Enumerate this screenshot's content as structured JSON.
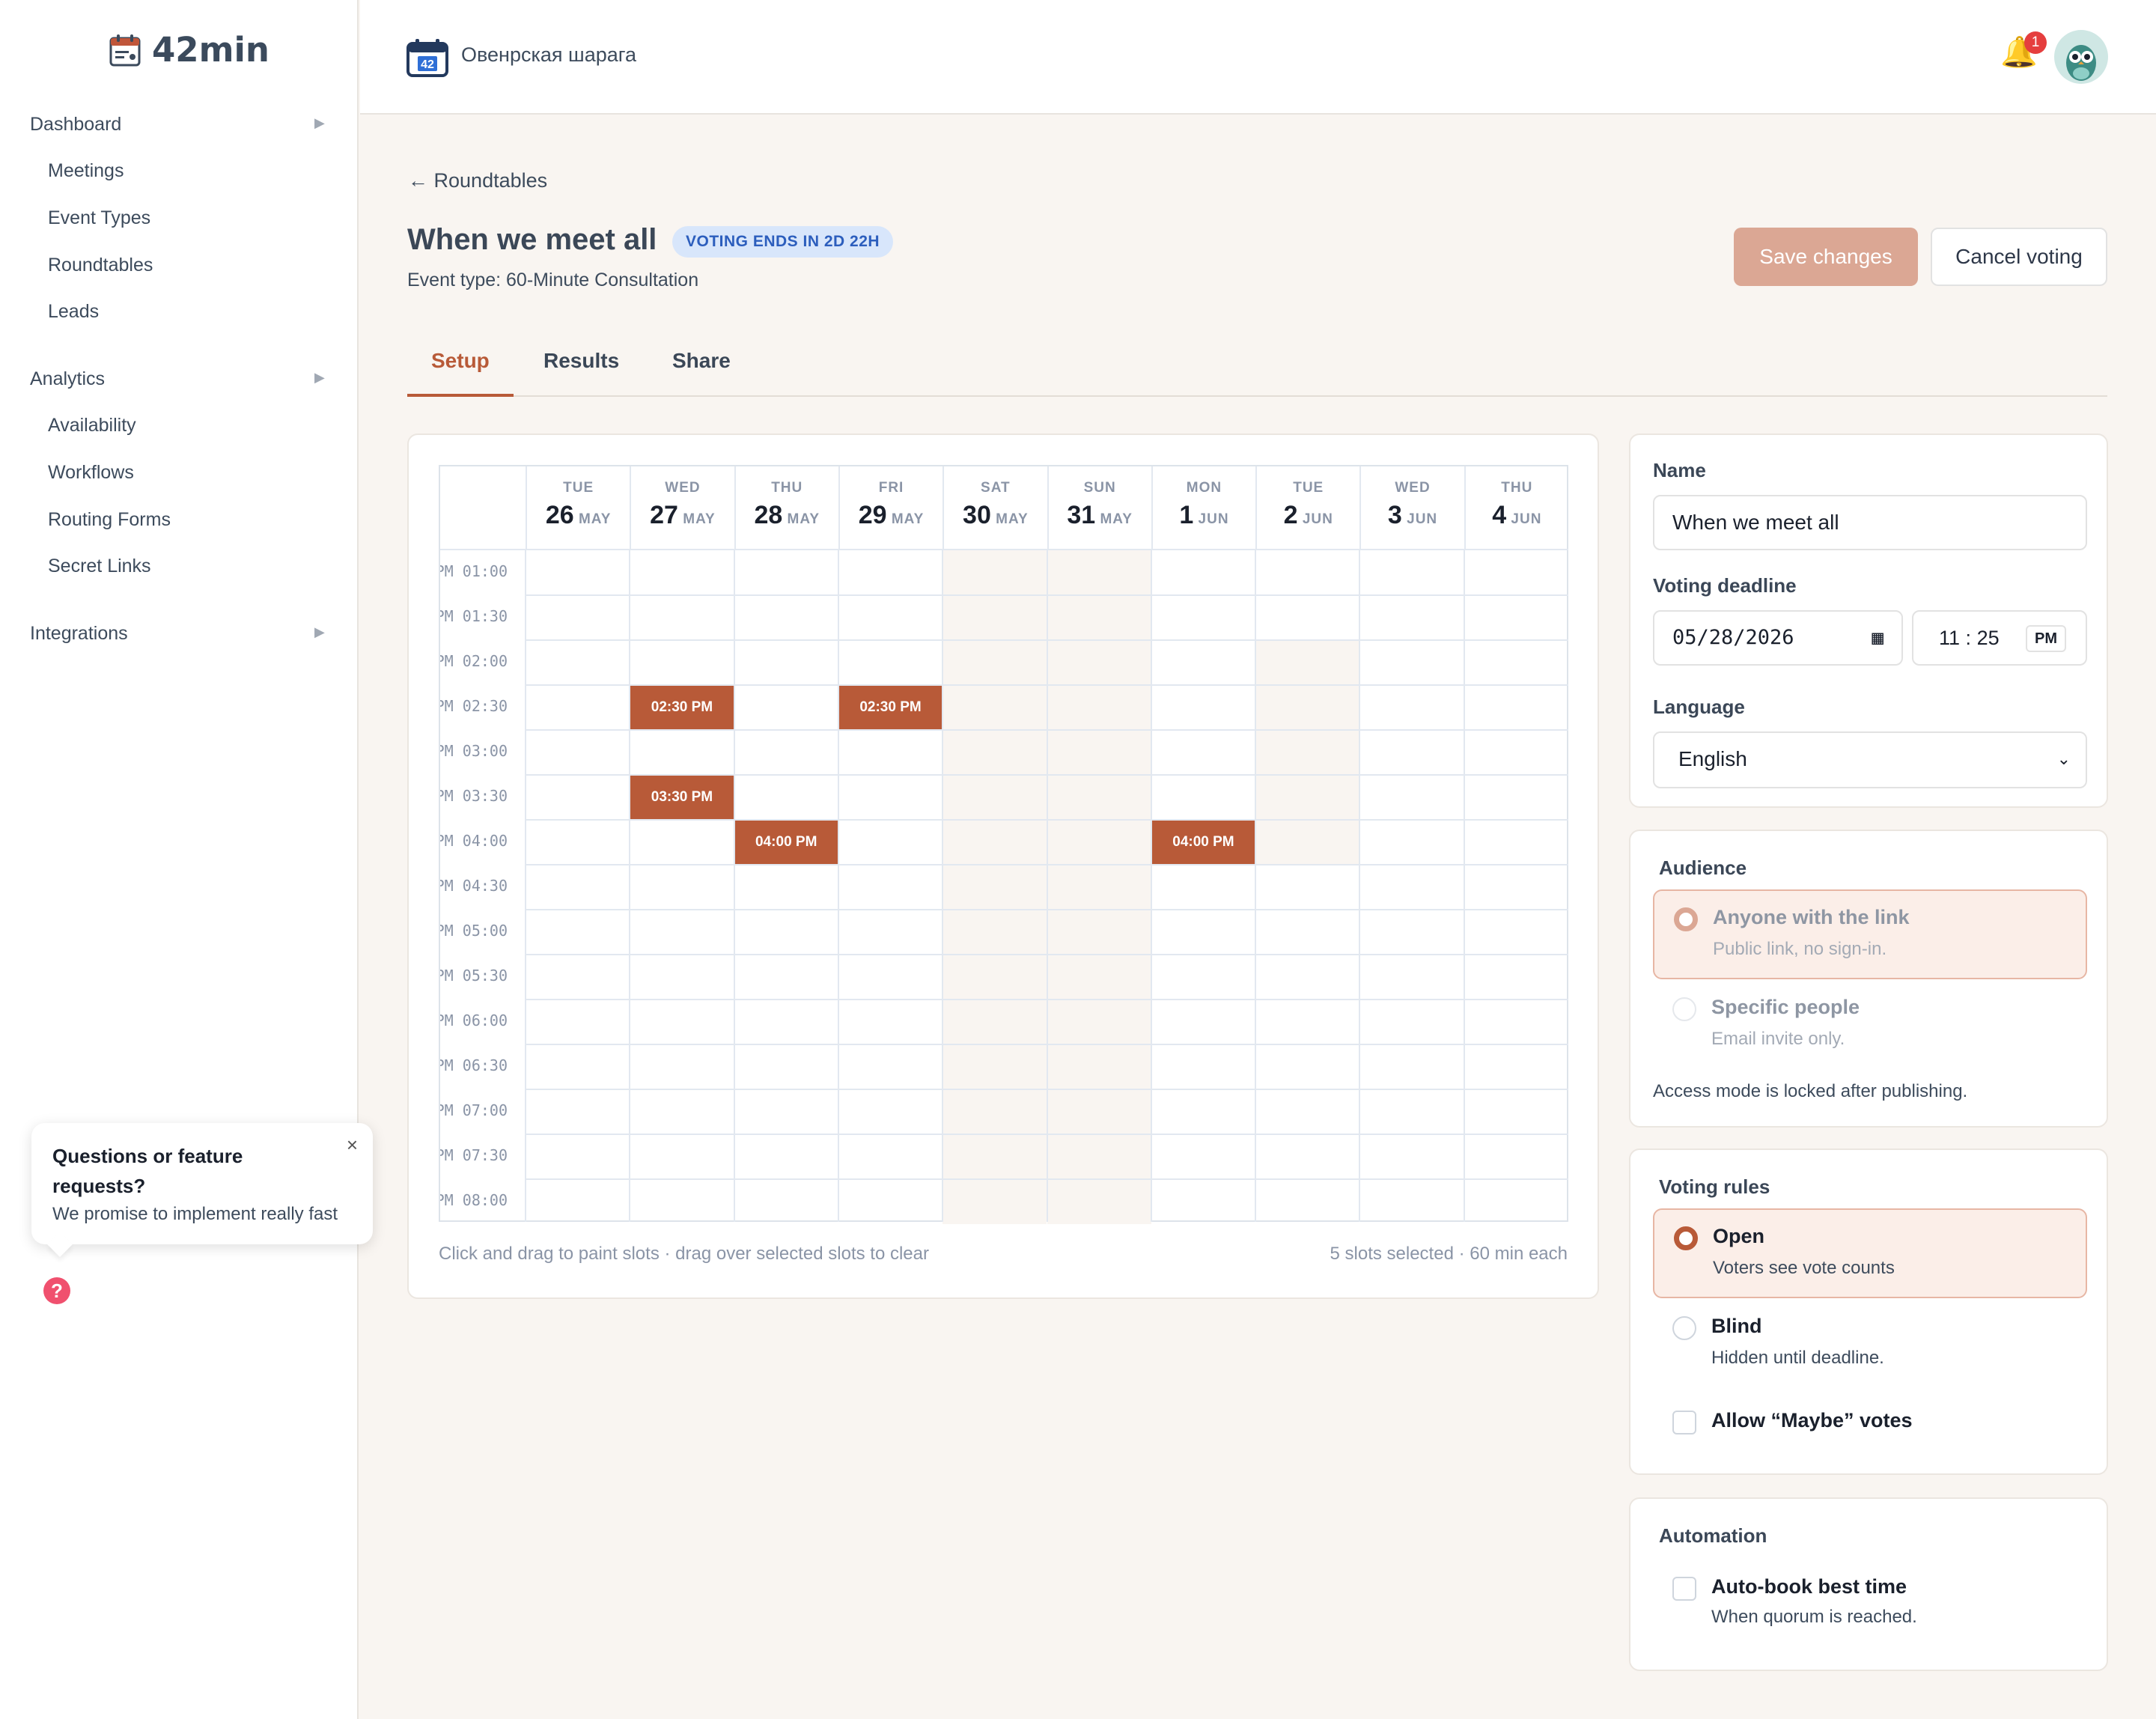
{
  "app": {
    "name": "42min"
  },
  "sidebar": {
    "groups": [
      {
        "label": "Dashboard",
        "items": [
          "Meetings",
          "Event Types",
          "Roundtables",
          "Leads"
        ]
      },
      {
        "label": "Analytics",
        "items": [
          "Availability",
          "Workflows",
          "Routing Forms",
          "Secret Links"
        ]
      },
      {
        "label": "Integrations",
        "items": []
      }
    ]
  },
  "help": {
    "title": "Questions or feature requests?",
    "subtitle": "We promise to implement really fast",
    "close": "×",
    "icon": "?"
  },
  "topbar": {
    "workspace": "Овенрская шарага",
    "workspace_icon_num": "42",
    "notifications": "1"
  },
  "page": {
    "back_label": "Roundtables",
    "title": "When we meet all",
    "voting_badge": "VOTING ENDS IN 2D 22H",
    "event_type": "Event type: 60-Minute Consultation",
    "save_label": "Save changes",
    "cancel_label": "Cancel voting",
    "tabs": [
      "Setup",
      "Results",
      "Share"
    ],
    "active_tab": "Setup"
  },
  "calendar": {
    "days": [
      {
        "dow": "TUE",
        "day": "26",
        "mon": "MAY"
      },
      {
        "dow": "WED",
        "day": "27",
        "mon": "MAY"
      },
      {
        "dow": "THU",
        "day": "28",
        "mon": "MAY"
      },
      {
        "dow": "FRI",
        "day": "29",
        "mon": "MAY"
      },
      {
        "dow": "SAT",
        "day": "30",
        "mon": "MAY"
      },
      {
        "dow": "SUN",
        "day": "31",
        "mon": "MAY"
      },
      {
        "dow": "MON",
        "day": "1",
        "mon": "JUN"
      },
      {
        "dow": "TUE",
        "day": "2",
        "mon": "JUN"
      },
      {
        "dow": "WED",
        "day": "3",
        "mon": "JUN"
      },
      {
        "dow": "THU",
        "day": "4",
        "mon": "JUN"
      }
    ],
    "times": [
      "01:00 PM",
      "01:30 PM",
      "02:00 PM",
      "02:30 PM",
      "03:00 PM",
      "03:30 PM",
      "04:00 PM",
      "04:30 PM",
      "05:00 PM",
      "05:30 PM",
      "06:00 PM",
      "06:30 PM",
      "07:00 PM",
      "07:30 PM",
      "08:00 PM"
    ],
    "selected": [
      {
        "day": "WED 27 MAY",
        "label": "02:30 PM"
      },
      {
        "day": "FRI 29 MAY",
        "label": "02:30 PM"
      },
      {
        "day": "WED 27 MAY",
        "label": "03:30 PM"
      },
      {
        "day": "THU 28 MAY",
        "label": "04:00 PM"
      },
      {
        "day": "MON 1 JUN",
        "label": "04:00 PM"
      }
    ],
    "hint": "Click and drag to paint slots · drag over selected slots to clear",
    "count": "5 slots selected · 60 min each"
  },
  "form": {
    "name_label": "Name",
    "name_value": "When we meet all",
    "deadline_label": "Voting deadline",
    "deadline_date": "05/28/2026",
    "deadline_hour": "11",
    "deadline_min": "25",
    "deadline_ampm": "PM",
    "language_label": "Language",
    "language_value": "English"
  },
  "audience": {
    "label": "Audience",
    "options": [
      {
        "title": "Anyone with the link",
        "sub": "Public link, no sign-in.",
        "selected": true
      },
      {
        "title": "Specific people",
        "sub": "Email invite only.",
        "selected": false
      }
    ],
    "note": "Access mode is locked after publishing."
  },
  "voting_rules": {
    "label": "Voting rules",
    "options": [
      {
        "title": "Open",
        "sub": "Voters see vote counts",
        "selected": true
      },
      {
        "title": "Blind",
        "sub": "Hidden until deadline.",
        "selected": false
      }
    ],
    "maybe_label": "Allow “Maybe” votes"
  },
  "automation": {
    "label": "Automation",
    "title": "Auto-book best time",
    "sub": "When quorum is reached."
  },
  "colors": {
    "accent": "#b85a38",
    "accent_light": "#dba794",
    "badge_bg": "#d8e6fb",
    "background": "#f9f5f1"
  }
}
